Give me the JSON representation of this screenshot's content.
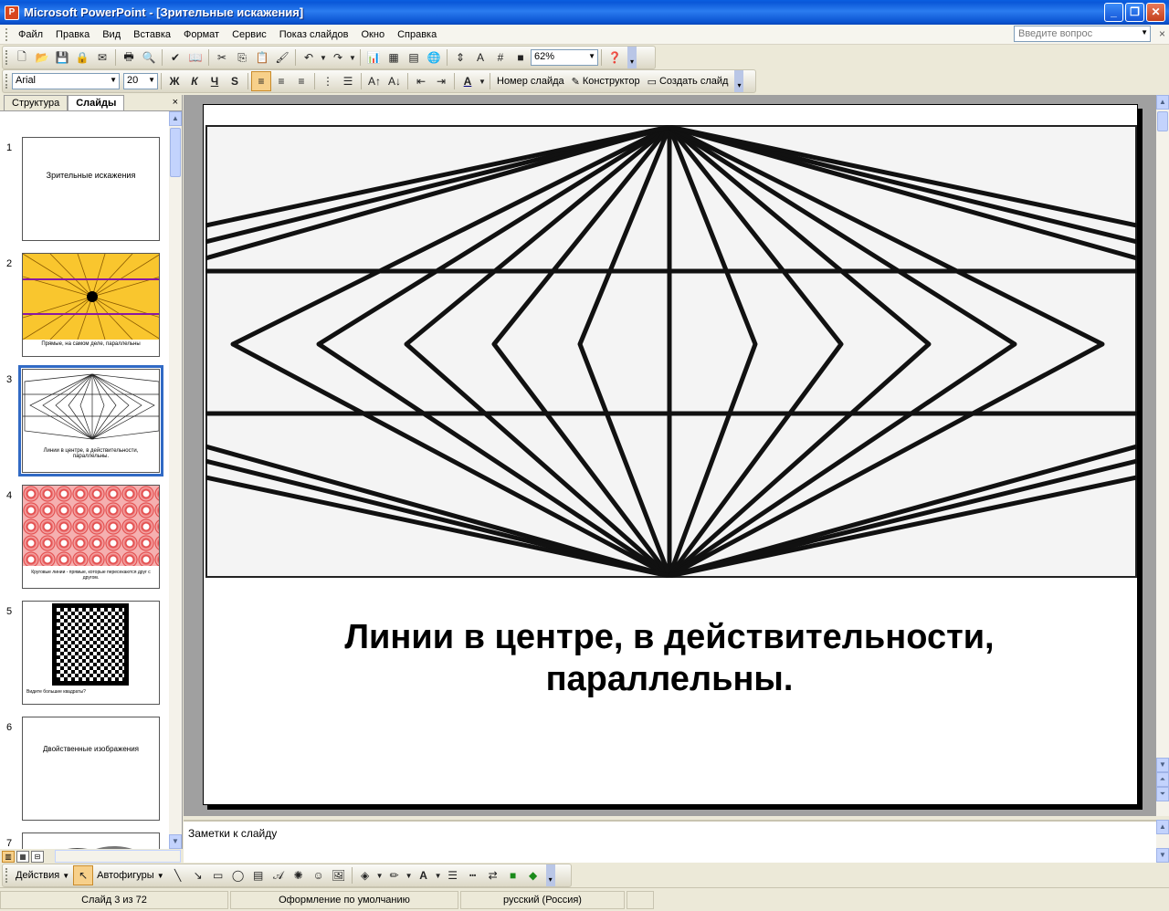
{
  "window": {
    "title": "Microsoft PowerPoint - [Зрительные искажения]",
    "icon": "powerpoint-app-icon",
    "min": "_",
    "restore": "❐",
    "close": "✕"
  },
  "menu": {
    "items": [
      "Файл",
      "Правка",
      "Вид",
      "Вставка",
      "Формат",
      "Сервис",
      "Показ слайдов",
      "Окно",
      "Справка"
    ],
    "help_placeholder": "Введите вопрос"
  },
  "standard_toolbar": {
    "zoom": "62%"
  },
  "format_toolbar": {
    "font": "Arial",
    "size": "20",
    "bold": "Ж",
    "italic": "К",
    "underline": "Ч",
    "shadow": "S",
    "slide_number": "Номер слайда",
    "designer": "Конструктор",
    "new_slide": "Создать слайд"
  },
  "left_pane": {
    "tab_outline": "Структура",
    "tab_slides": "Слайды",
    "close": "×",
    "thumbnails": [
      {
        "num": "1",
        "caption": "Зрительные искажения"
      },
      {
        "num": "2",
        "caption": "Прямые, на самом деле, параллельны"
      },
      {
        "num": "3",
        "caption": "Линии в центре, в действительности, параллельны."
      },
      {
        "num": "4",
        "caption": "Круговые линии - прямые, которые пересекаются друг с другом."
      },
      {
        "num": "5",
        "caption": "Видите большие квадраты?"
      },
      {
        "num": "6",
        "caption": "Двойственные изображения"
      },
      {
        "num": "7",
        "caption": ""
      }
    ],
    "selected_index": 2
  },
  "slide": {
    "caption_line1": "Линии в центре, в действительности,",
    "caption_line2": "параллельны."
  },
  "notes": {
    "placeholder": "Заметки к слайду"
  },
  "draw_toolbar": {
    "actions": "Действия",
    "autoshapes": "Автофигуры"
  },
  "status": {
    "slide_of": "Слайд 3 из 72",
    "design": "Оформление по умолчанию",
    "language": "русский (Россия)"
  },
  "colors": {
    "titlebar": "#0a58d8",
    "selection": "#316ac5",
    "slide2_bg": "#f9c62e",
    "slide2_lines": "#8a1aa0",
    "slide4_pattern": "#e03a3a"
  }
}
